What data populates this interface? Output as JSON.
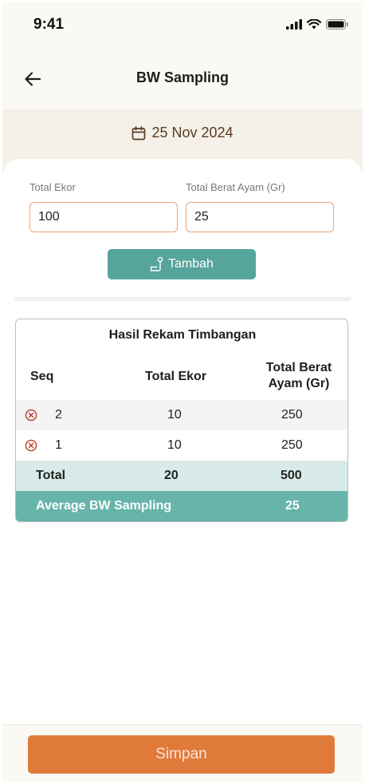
{
  "status_bar": {
    "time": "9:41"
  },
  "header": {
    "title": "BW Sampling"
  },
  "date": {
    "value": "25 Nov 2024"
  },
  "form": {
    "total_ekor": {
      "label": "Total Ekor",
      "value": "100"
    },
    "total_berat": {
      "label": "Total Berat Ayam (Gr)",
      "value": "25"
    },
    "add_button_label": "Tambah"
  },
  "table": {
    "title": "Hasil Rekam Timbangan",
    "headers": {
      "seq": "Seq",
      "total_ekor": "Total Ekor",
      "total_berat_line1": "Total Berat",
      "total_berat_line2": "Ayam (Gr)"
    },
    "rows": [
      {
        "seq": "2",
        "total_ekor": "10",
        "total_berat": "250"
      },
      {
        "seq": "1",
        "total_ekor": "10",
        "total_berat": "250"
      }
    ],
    "total": {
      "label": "Total",
      "total_ekor": "20",
      "total_berat": "500"
    },
    "average": {
      "label": "Average BW Sampling",
      "value": "25"
    }
  },
  "footer": {
    "save_label": "Simpan"
  },
  "colors": {
    "accent": "#56a59b",
    "save": "#e07a3b",
    "input_border": "#e8a57a",
    "delete": "#c0392b"
  },
  "icons": {
    "back": "arrow-left-icon",
    "calendar": "calendar-icon",
    "scale": "scale-icon",
    "delete": "x-circle-icon"
  }
}
